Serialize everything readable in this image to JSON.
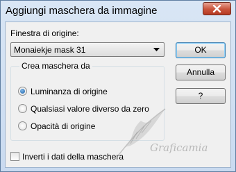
{
  "window": {
    "title": "Aggiungi maschera da immagine",
    "close_icon": "close-icon"
  },
  "source": {
    "label": "Finestra di origine:",
    "selected": "Monaiekje mask 31"
  },
  "buttons": {
    "ok": "OK",
    "cancel": "Annulla",
    "help": "?"
  },
  "group": {
    "title": "Crea maschera da",
    "options": [
      {
        "label": "Luminanza di origine",
        "checked": true
      },
      {
        "label": "Qualsiasi valore diverso da zero",
        "checked": false
      },
      {
        "label": "Opacità di origine",
        "checked": false
      }
    ]
  },
  "invert": {
    "label": "Inverti i dati della maschera",
    "checked": false
  },
  "watermark": {
    "text": "Graficamia"
  },
  "colors": {
    "title_bg": "#d3e2f3",
    "close_red": "#c9543b",
    "client_bg": "#f0f0f0",
    "default_border": "#3c7fb1"
  }
}
